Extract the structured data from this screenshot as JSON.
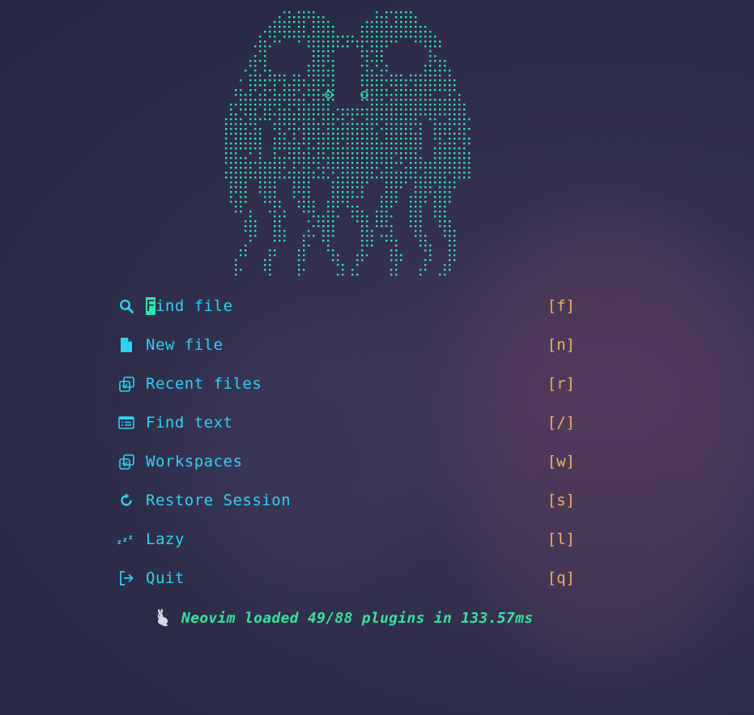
{
  "dashboard": {
    "menu": [
      {
        "icon": "search-icon",
        "label": "Find file",
        "cursor_char": "F",
        "rest": "ind file",
        "key": "[f]"
      },
      {
        "icon": "new-file-icon",
        "label": "New file",
        "key": "[n]"
      },
      {
        "icon": "recent-files-icon",
        "label": "Recent files",
        "key": "[r]"
      },
      {
        "icon": "find-text-icon",
        "label": "Find text",
        "key": "[/]"
      },
      {
        "icon": "workspaces-icon",
        "label": "Workspaces",
        "key": "[w]"
      },
      {
        "icon": "restore-session-icon",
        "label": "Restore Session",
        "key": "[s]"
      },
      {
        "icon": "lazy-sleep-icon",
        "label": "Lazy",
        "key": "[l]"
      },
      {
        "icon": "quit-icon",
        "label": "Quit",
        "key": "[q]"
      }
    ],
    "footer": {
      "icon": "rabbit-icon",
      "text": "Neovim loaded 49/88 plugins in 133.57ms"
    }
  },
  "colors": {
    "accent": "#2bd3f5",
    "key": "#f0b060",
    "art": "#2de3b2",
    "footer": "#35e49c"
  }
}
